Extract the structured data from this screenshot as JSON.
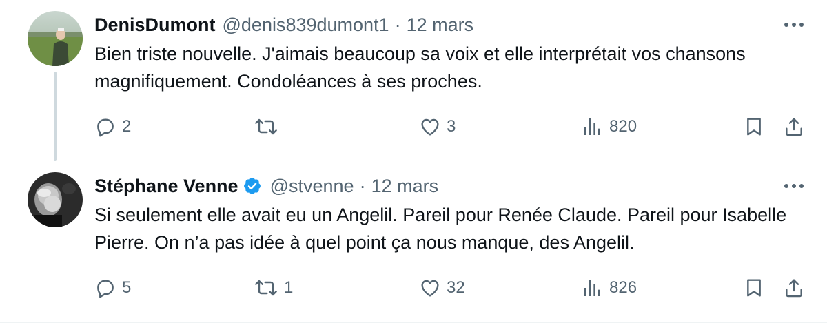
{
  "tweets": [
    {
      "display_name": "DenisDumont",
      "handle": "@denis839dumont1",
      "separator": "·",
      "date": "12 mars",
      "verified": false,
      "text": "Bien triste nouvelle.  J'aimais beaucoup sa voix et elle interprétait vos chansons magnifiquement. Condoléances à ses proches.",
      "stats": {
        "replies": "2",
        "retweets": "",
        "likes": "3",
        "views": "820"
      }
    },
    {
      "display_name": "Stéphane Venne",
      "handle": "@stvenne",
      "separator": "·",
      "date": "12 mars",
      "verified": true,
      "text": "Si seulement elle avait eu un Angelil. Pareil pour Renée Claude. Pareil pour Isabelle Pierre. On n’a pas idée à quel point ça nous manque, des Angelil.",
      "stats": {
        "replies": "5",
        "retweets": "1",
        "likes": "32",
        "views": "826"
      }
    }
  ],
  "icons": {
    "reply": "reply-icon",
    "retweet": "retweet-icon",
    "like": "heart-icon",
    "views": "views-icon",
    "bookmark": "bookmark-icon",
    "share": "share-icon",
    "more": "more-icon",
    "verified": "verified-badge-icon"
  },
  "colors": {
    "text_primary": "#0f1419",
    "text_secondary": "#536471",
    "verified_blue": "#1d9bf0",
    "thread_line": "#cfd9de"
  }
}
